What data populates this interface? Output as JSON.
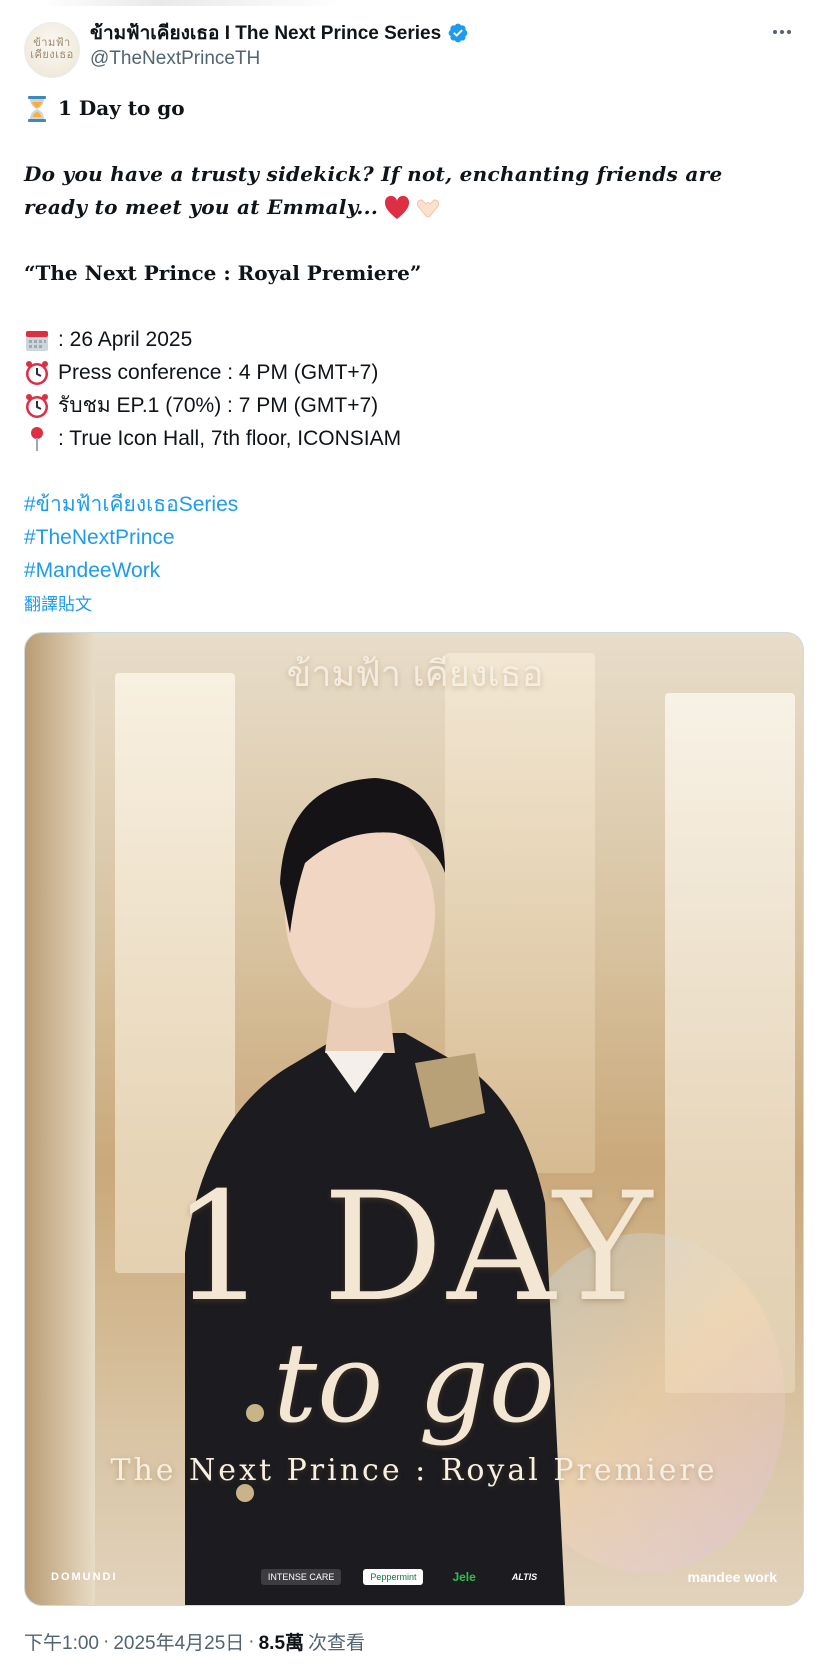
{
  "header": {
    "display_name": "ข้ามฟ้าเคียงเธอ I The Next Prince Series",
    "handle": "@TheNextPrinceTH",
    "avatar_text": "ข้ามฟ้า เคียงเธอ",
    "icons": {
      "verified": "verified-badge-icon",
      "more": "more-options-icon"
    }
  },
  "tweet": {
    "line1": "1 Day to go",
    "line2": "Do you have a trusty sidekick? If not, enchanting friends are",
    "line3": "ready to meet you at Emmaly...",
    "title_line": "“The Next Prince : Royal Premiere”",
    "date_line": ": 26 April 2025",
    "press_line": "Press conference : 4 PM (GMT+7)",
    "watch_line": "รับชม EP.1 (70%) : 7 PM (GMT+7)",
    "venue_line": ": True Icon Hall, 7th floor, ICONSIAM",
    "hashtags": [
      "#ข้ามฟ้าเคียงเธอSeries",
      "#TheNextPrince",
      "#MandeeWork"
    ],
    "translate": "翻譯貼文",
    "emoji_icons": [
      "hourglass-icon",
      "heart-icon",
      "calendar-icon",
      "alarm-clock-icon",
      "pin-icon"
    ]
  },
  "media": {
    "logo_text": "ข้ามฟ้า เคียงเธอ",
    "headline_1": "1 DAY",
    "headline_2": "to go",
    "subtitle": "The Next Prince : Royal Premiere",
    "sponsor_left": "DOMUNDI",
    "sponsor_right": "mandee work",
    "sponsors_mid": [
      "INTENSE CARE",
      "Peppermint",
      "Jele",
      "ALTIS"
    ]
  },
  "meta": {
    "time": "下午1:00",
    "separator": "·",
    "date": "2025年4月25日",
    "views_count": "8.5萬",
    "views_label": "次查看"
  },
  "colors": {
    "link": "#1d9bf0",
    "secondary": "#536471",
    "verified": "#1d9bf0"
  }
}
